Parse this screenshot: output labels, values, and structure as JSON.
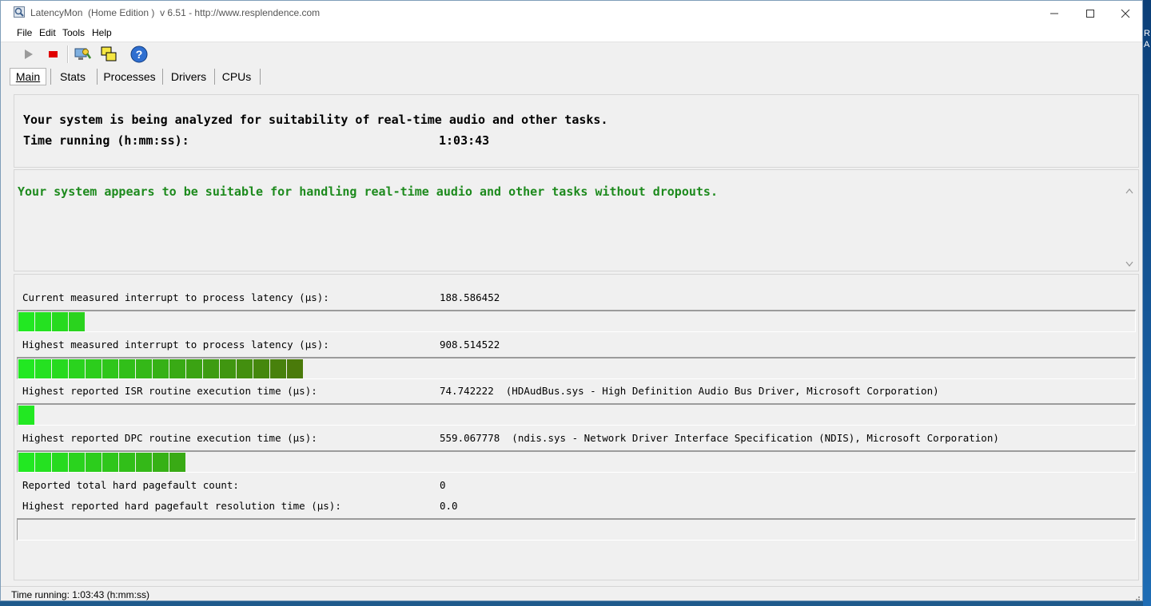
{
  "window": {
    "title": "LatencyMon  (Home Edition )  v 6.51 - http://www.resplendence.com"
  },
  "desktop": {
    "side_glyphs": [
      "R",
      "A"
    ]
  },
  "menu": [
    "File",
    "Edit",
    "Tools",
    "Help"
  ],
  "toolbar": {
    "icons": [
      "play-icon",
      "stop-icon",
      "system-info-icon",
      "windows-icon",
      "help-icon"
    ]
  },
  "tabs": [
    "Main",
    "Stats",
    "Processes",
    "Drivers",
    "CPUs"
  ],
  "active_tab": "Main",
  "summary": {
    "line1": "Your system is being analyzed for suitability of real-time audio and other tasks.",
    "time_label": "Time running (h:mm:ss):",
    "time_value": "1:03:43"
  },
  "verdict": {
    "text": "Your system appears to be suitable for handling real-time audio and other tasks without dropouts."
  },
  "metrics": {
    "current_latency": {
      "label": "Current measured interrupt to process latency (µs):",
      "value": "188.586452",
      "segments": 4
    },
    "highest_latency": {
      "label": "Highest measured interrupt to process latency (µs):",
      "value": "908.514522",
      "segments": 17
    },
    "isr": {
      "label": "Highest reported ISR routine execution time (µs):",
      "value": "74.742222  (HDAudBus.sys - High Definition Audio Bus Driver, Microsoft Corporation)",
      "segments": 1
    },
    "dpc": {
      "label": "Highest reported DPC routine execution time (µs):",
      "value": "559.067778  (ndis.sys - Network Driver Interface Specification (NDIS), Microsoft Corporation)",
      "segments": 10
    },
    "pagefault_count": {
      "label": "Reported total hard pagefault count:",
      "value": "0"
    },
    "pagefault_time": {
      "label": "Highest reported hard pagefault resolution time (µs):",
      "value": "0.0",
      "segments": 0
    }
  },
  "colors": {
    "verdict_green": "#1d8a1d",
    "bar_start": "#22e822",
    "bar_end": "#4a7a0a"
  },
  "statusbar": {
    "text": "Time running: 1:03:43  (h:mm:ss)"
  }
}
